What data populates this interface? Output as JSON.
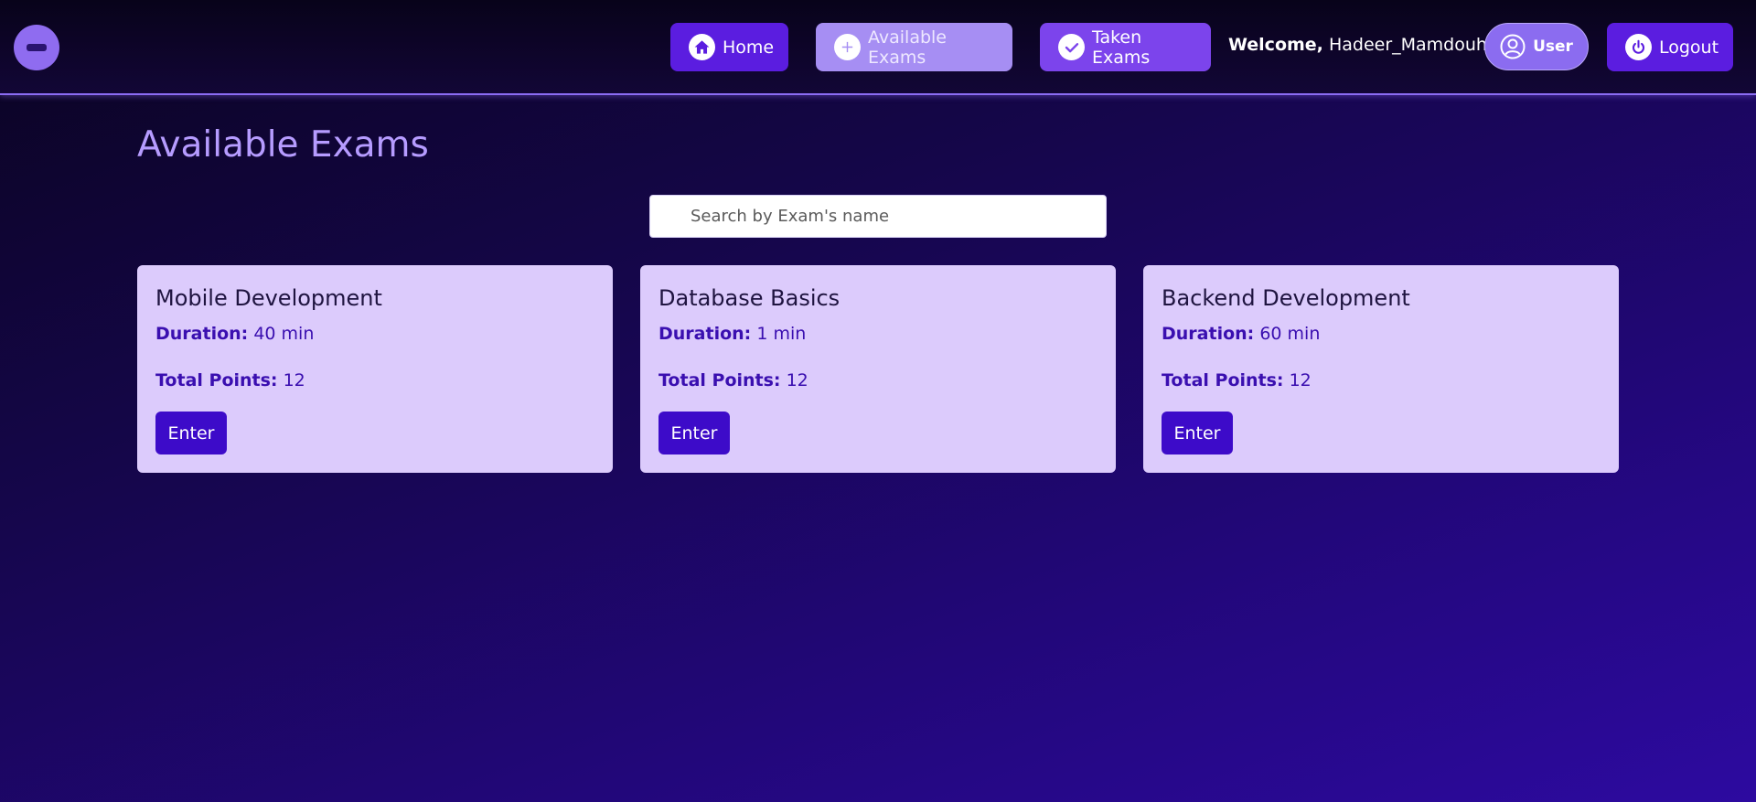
{
  "nav": {
    "home_label": "Home",
    "available_label": "Available Exams",
    "taken_label": "Taken Exams",
    "welcome_prefix": "Welcome,",
    "username": "Hadeer_Mamdouh",
    "user_label": "User",
    "logout_label": "Logout",
    "icons": {
      "home": "home-icon",
      "available": "plus-circle-icon",
      "taken": "check-circle-icon",
      "user": "user-circle-icon",
      "logout": "power-icon"
    }
  },
  "page": {
    "title": "Available Exams"
  },
  "search": {
    "placeholder": "Search by Exam's name",
    "value": ""
  },
  "exams": [
    {
      "name": "Mobile Development",
      "duration_label": "Duration:",
      "duration": "40 min",
      "points_label": "Total Points:",
      "points": "12",
      "enter_label": "Enter"
    },
    {
      "name": "Database Basics",
      "duration_label": "Duration:",
      "duration": "1 min",
      "points_label": "Total Points:",
      "points": "12",
      "enter_label": "Enter"
    },
    {
      "name": "Backend Development",
      "duration_label": "Duration:",
      "duration": "60 min",
      "points_label": "Total Points:",
      "points": "12",
      "enter_label": "Enter"
    }
  ],
  "colors": {
    "accent": "#5b1de0",
    "title": "#b69cff",
    "card_bg": "#dccbfc",
    "enter_btn": "#3d0bc9"
  }
}
